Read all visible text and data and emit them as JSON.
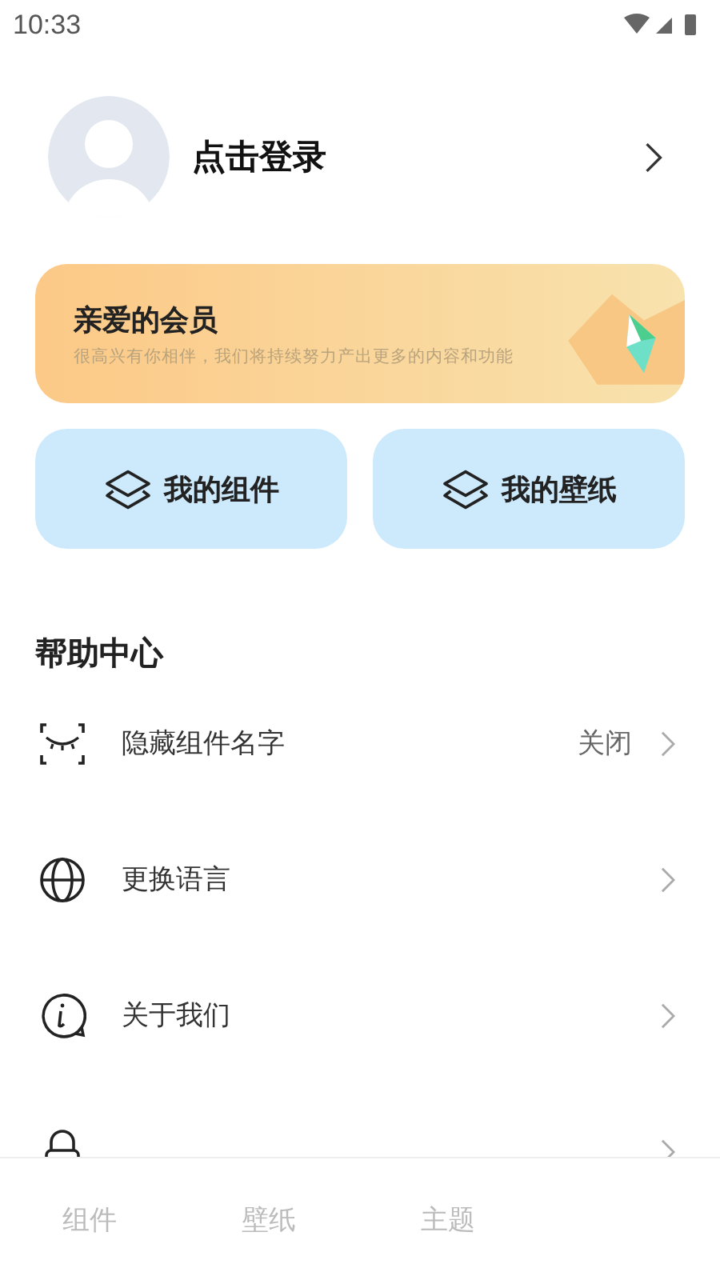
{
  "status_bar": {
    "time": "10:33"
  },
  "profile": {
    "login_text": "点击登录"
  },
  "member_card": {
    "title": "亲爱的会员",
    "subtitle": "很高兴有你相伴，我们将持续努力产出更多的内容和功能"
  },
  "shortcuts": [
    {
      "label": "我的组件"
    },
    {
      "label": "我的壁纸"
    }
  ],
  "help_center": {
    "title": "帮助中心",
    "items": [
      {
        "kind": "eye",
        "label": "隐藏组件名字",
        "value": "关闭"
      },
      {
        "kind": "globe",
        "label": "更换语言"
      },
      {
        "kind": "info",
        "label": "关于我们"
      },
      {
        "kind": "lock"
      }
    ]
  },
  "bottom_nav": [
    {
      "label": "组件",
      "selected": false
    },
    {
      "label": "壁纸",
      "selected": false
    },
    {
      "label": "主题",
      "selected": false
    }
  ]
}
